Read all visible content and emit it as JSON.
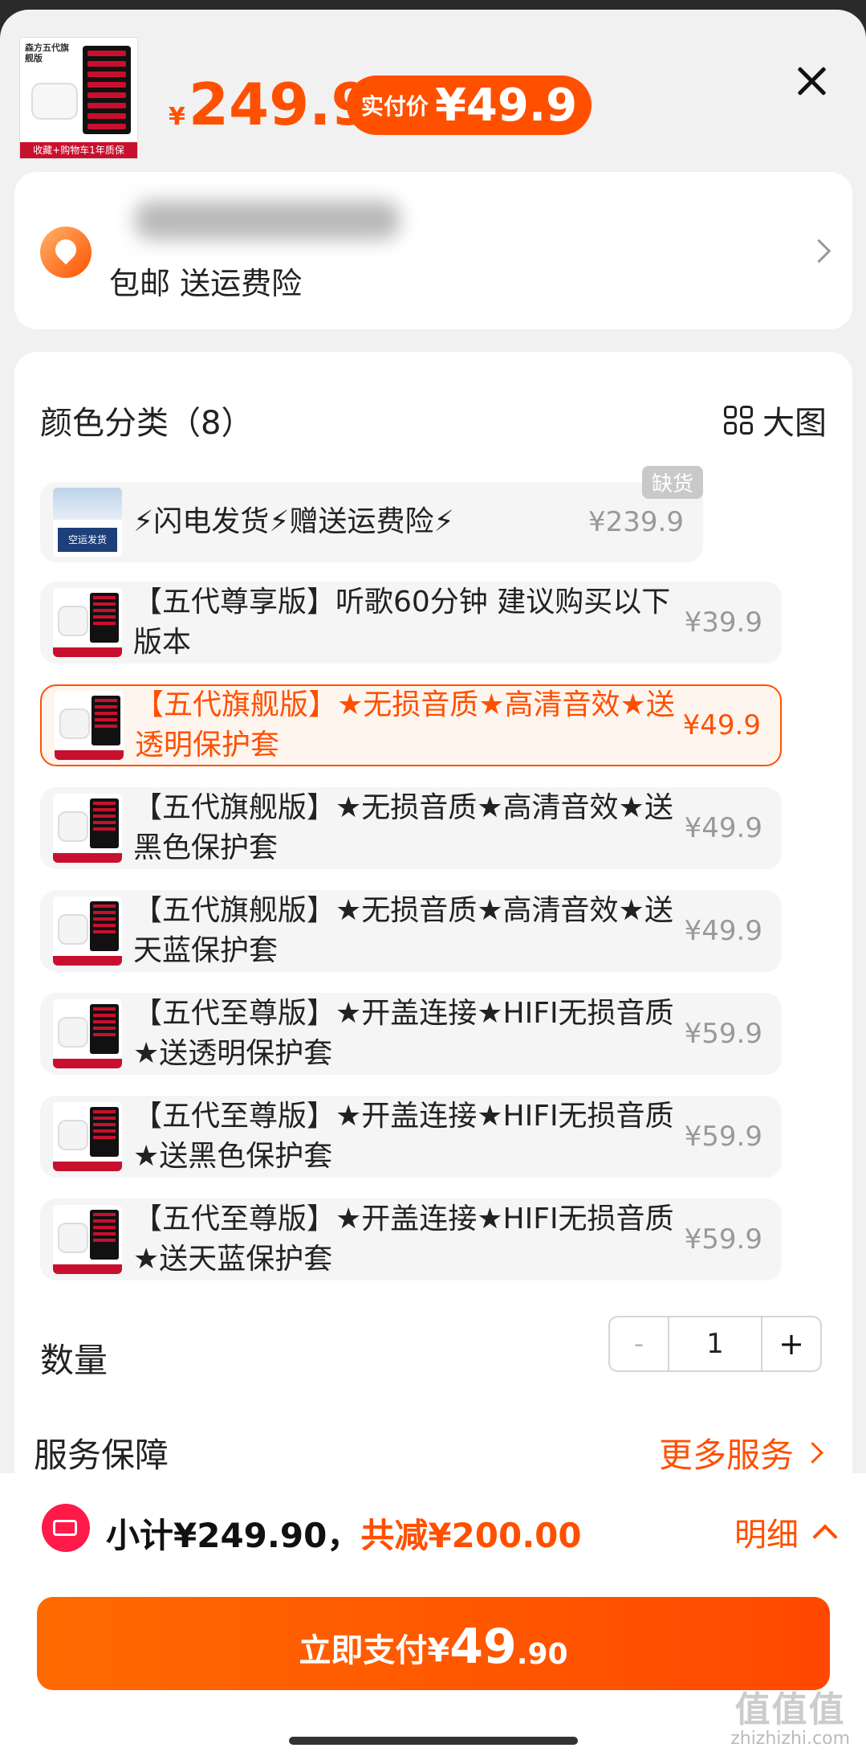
{
  "header": {
    "thumb_title": "森方五代旗舰版",
    "thumb_band": "收藏+购物车1年质保",
    "currency": "¥",
    "price": "249.9",
    "pay_label": "实付价",
    "pay_value": "¥49.9"
  },
  "address": {
    "name": "",
    "shipping": "包邮 送运费险"
  },
  "sku": {
    "title": "颜色分类（8）",
    "big_image": "大图",
    "out_of_stock": "缺货",
    "options": [
      {
        "label": "⚡闪电发货⚡赠送运费险⚡",
        "price": "¥239.9",
        "state": "disabled",
        "pic_text": "空运发货"
      },
      {
        "label": "【五代尊享版】听歌60分钟 建议购买以下版本",
        "price": "¥39.9",
        "state": "normal"
      },
      {
        "label": "【五代旗舰版】★无损音质★高清音效★送透明保护套",
        "price": "¥49.9",
        "state": "selected"
      },
      {
        "label": "【五代旗舰版】★无损音质★高清音效★送黑色保护套",
        "price": "¥49.9",
        "state": "normal"
      },
      {
        "label": "【五代旗舰版】★无损音质★高清音效★送天蓝保护套",
        "price": "¥49.9",
        "state": "normal"
      },
      {
        "label": "【五代至尊版】★开盖连接★HIFI无损音质★送透明保护套",
        "price": "¥59.9",
        "state": "normal"
      },
      {
        "label": "【五代至尊版】★开盖连接★HIFI无损音质★送黑色保护套",
        "price": "¥59.9",
        "state": "normal"
      },
      {
        "label": "【五代至尊版】★开盖连接★HIFI无损音质★送天蓝保护套",
        "price": "¥59.9",
        "state": "normal"
      }
    ]
  },
  "quantity": {
    "label": "数量",
    "minus": "-",
    "value": "1",
    "plus": "+"
  },
  "service": {
    "label": "服务保障",
    "more": "更多服务"
  },
  "footer": {
    "subtotal": "小计¥249.90，",
    "discount": "共减¥200.00",
    "detail": "明细",
    "pay_a": "立即支付¥",
    "pay_b": "49",
    "pay_c": ".90"
  },
  "watermark": {
    "big": "值值值",
    "small": "zhizhizhi.com"
  },
  "colors": {
    "accent": "#ff5000",
    "background": "#f1f1f1"
  }
}
